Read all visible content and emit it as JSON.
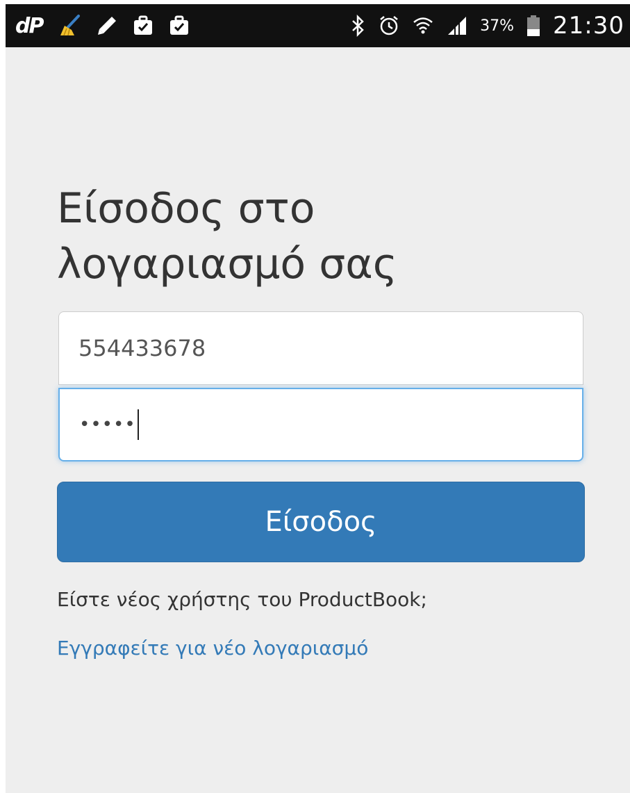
{
  "status_bar": {
    "left_icons": [
      "dp-icon",
      "broom-cleaner-icon",
      "pencil-icon",
      "briefcase-check-icon",
      "briefcase-check-icon"
    ],
    "dp_label": "dP",
    "right_icons": [
      "bluetooth-icon",
      "alarm-icon",
      "wifi-icon",
      "signal-icon",
      "battery-icon"
    ],
    "battery_percent": "37%",
    "battery_level": 0.37,
    "time": "21:30"
  },
  "login": {
    "title_line1": "Είσοδος στο",
    "title_line2": "λογαριασμό σας",
    "username_value": "554433678",
    "password_masked": "•••••",
    "submit_label": "Είσοδος",
    "new_user_prompt": "Είστε νέος χρήστης του ProductBook;",
    "register_link": "Εγγραφείτε για νέο λογαριασμό"
  },
  "colors": {
    "status_bar_bg": "#111111",
    "page_bg": "#eeeeee",
    "primary": "#337ab7",
    "focus_border": "#66afe9",
    "icon_accent_yellow": "#f2c12e",
    "icon_accent_blue": "#3a7fc4"
  }
}
